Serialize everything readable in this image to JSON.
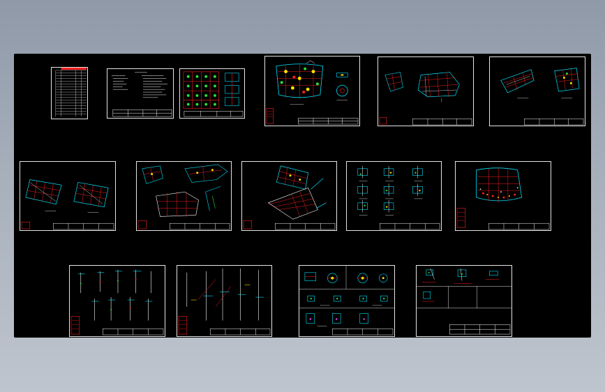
{
  "app": {
    "background_top": "#8f99a8",
    "background_bottom": "#bfc5ce",
    "viewport_color": "#000000"
  },
  "palette": {
    "sheet_border": "#e6e6e6",
    "red": "#ff2020",
    "cyan": "#00e5ff",
    "green": "#27e03a",
    "yellow": "#ffe000",
    "white": "#ffffff",
    "magenta": "#ff40ff"
  },
  "sheets": [
    {
      "id": "sheet-1",
      "kind": "table"
    },
    {
      "id": "sheet-2",
      "kind": "notes"
    },
    {
      "id": "sheet-3",
      "kind": "detail-grid"
    },
    {
      "id": "sheet-4",
      "kind": "plan"
    },
    {
      "id": "sheet-5",
      "kind": "plan"
    },
    {
      "id": "sheet-6",
      "kind": "plan"
    },
    {
      "id": "sheet-7",
      "kind": "plan"
    },
    {
      "id": "sheet-8",
      "kind": "plan"
    },
    {
      "id": "sheet-9",
      "kind": "plan"
    },
    {
      "id": "sheet-10",
      "kind": "detail-grid"
    },
    {
      "id": "sheet-11",
      "kind": "plan"
    },
    {
      "id": "sheet-12",
      "kind": "section"
    },
    {
      "id": "sheet-13",
      "kind": "section"
    },
    {
      "id": "sheet-14",
      "kind": "detail-grid"
    },
    {
      "id": "sheet-15",
      "kind": "detail-grid"
    }
  ]
}
